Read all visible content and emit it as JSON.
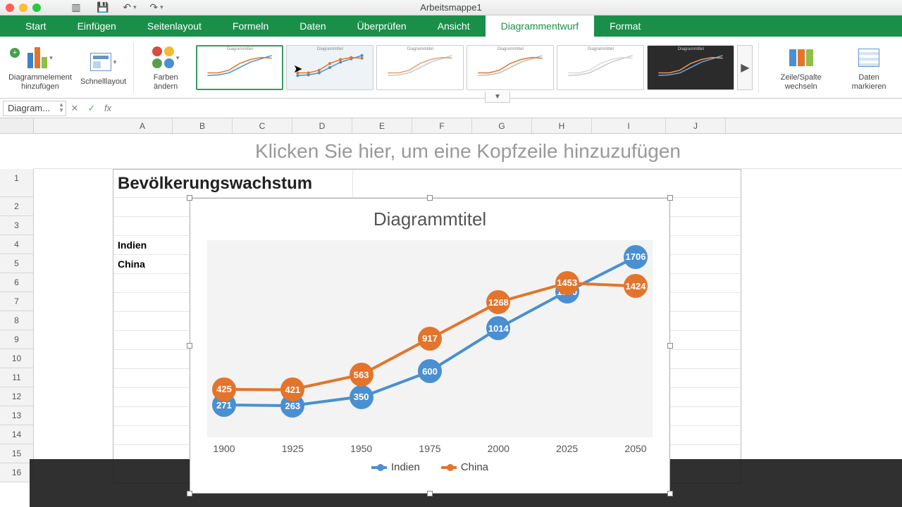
{
  "titlebar": {
    "workbook": "Arbeitsmappe1"
  },
  "tabs": [
    "Start",
    "Einfügen",
    "Seitenlayout",
    "Formeln",
    "Daten",
    "Überprüfen",
    "Ansicht",
    "Diagrammentwurf",
    "Format"
  ],
  "active_tab": 7,
  "ribbon": {
    "add_element": "Diagrammelement hinzufügen",
    "quick_layout": "Schnelllayout",
    "change_colors": "Farben ändern",
    "switch_rowcol": "Zeile/Spalte wechseln",
    "select_data": "Daten markieren",
    "style_thumbs_title": "Diagrammtitel"
  },
  "namebox": "Diagram...",
  "columns": [
    "A",
    "B",
    "C",
    "D",
    "E",
    "F",
    "G",
    "H",
    "I",
    "J"
  ],
  "rows": [
    "1",
    "2",
    "3",
    "4",
    "5",
    "6",
    "7",
    "8",
    "9",
    "10",
    "11",
    "12",
    "13",
    "14",
    "15",
    "16"
  ],
  "page_header_hint": "Klicken Sie hier, um eine Kopfzeile hinzuzufügen",
  "cell_A1": "Bevölkerungswachstum",
  "cell_A4": "Indien",
  "cell_A5": "China",
  "chart": {
    "title": "Diagrammtitel",
    "legend": {
      "series1": "Indien",
      "series2": "China"
    }
  },
  "chart_data": {
    "type": "line",
    "title": "Diagrammtitel",
    "categories": [
      "1900",
      "1925",
      "1950",
      "1975",
      "2000",
      "2025",
      "2050"
    ],
    "series": [
      {
        "name": "Indien",
        "color": "#4a8fd1",
        "values": [
          271,
          263,
          350,
          600,
          1014,
          1370,
          1706
        ]
      },
      {
        "name": "China",
        "color": "#e3742b",
        "values": [
          425,
          421,
          563,
          917,
          1268,
          1453,
          1424
        ]
      }
    ],
    "xlabel": "",
    "ylabel": "",
    "ylim": [
      0,
      1800
    ],
    "data_labels": true,
    "marker_style": "circle-large"
  }
}
